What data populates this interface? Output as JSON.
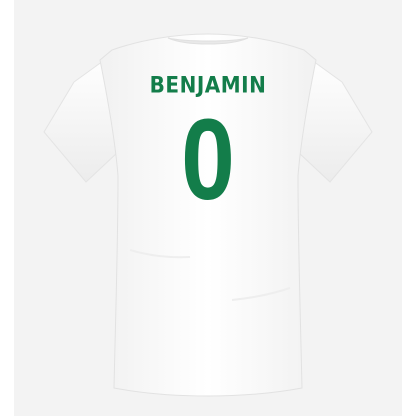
{
  "product": {
    "player_name": "BENJAMIN",
    "player_number": "0",
    "shirt_color": "#ffffff",
    "print_color": "#137d4a",
    "backdrop_color": "#f3f3f3"
  }
}
